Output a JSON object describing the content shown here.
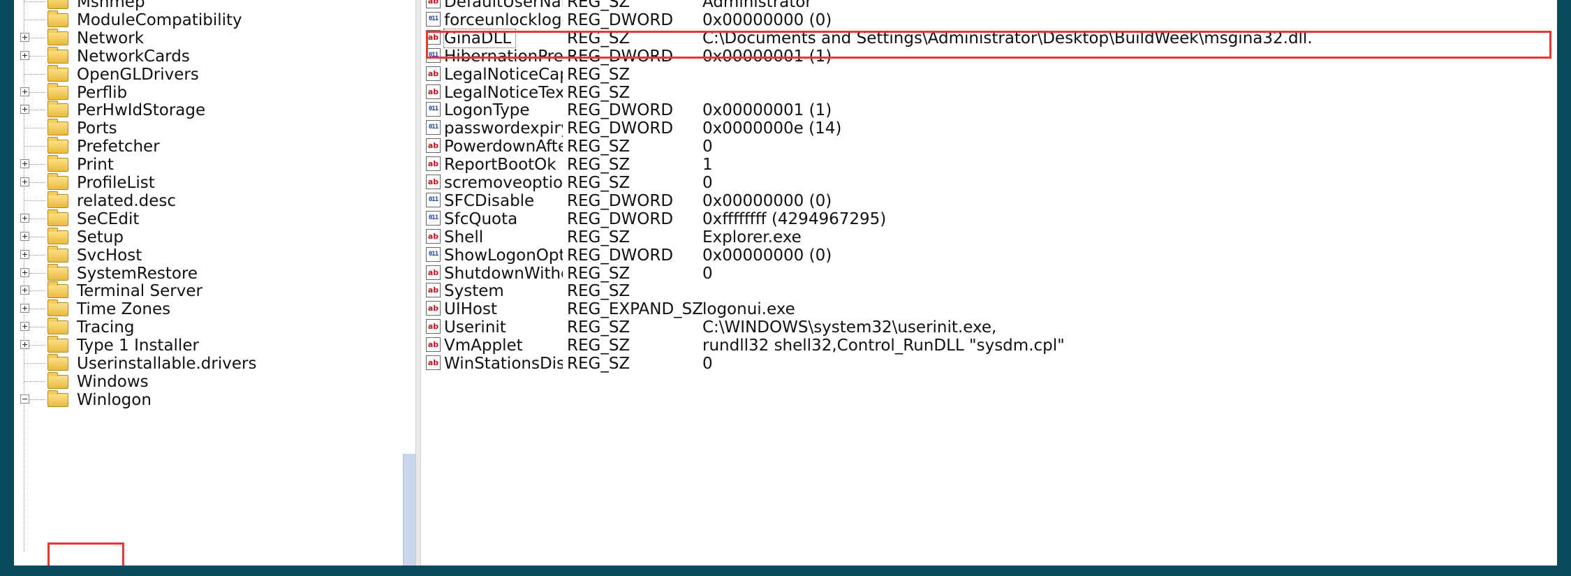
{
  "tree": {
    "items": [
      {
        "label": "Mshmep",
        "expander": "none"
      },
      {
        "label": "ModuleCompatibility",
        "expander": "none"
      },
      {
        "label": "Network",
        "expander": "plus"
      },
      {
        "label": "NetworkCards",
        "expander": "plus"
      },
      {
        "label": "OpenGLDrivers",
        "expander": "none"
      },
      {
        "label": "Perflib",
        "expander": "plus"
      },
      {
        "label": "PerHwIdStorage",
        "expander": "plus"
      },
      {
        "label": "Ports",
        "expander": "none"
      },
      {
        "label": "Prefetcher",
        "expander": "none"
      },
      {
        "label": "Print",
        "expander": "plus"
      },
      {
        "label": "ProfileList",
        "expander": "plus"
      },
      {
        "label": "related.desc",
        "expander": "none"
      },
      {
        "label": "SeCEdit",
        "expander": "plus"
      },
      {
        "label": "Setup",
        "expander": "plus"
      },
      {
        "label": "SvcHost",
        "expander": "plus"
      },
      {
        "label": "SystemRestore",
        "expander": "plus"
      },
      {
        "label": "Terminal Server",
        "expander": "plus"
      },
      {
        "label": "Time Zones",
        "expander": "plus"
      },
      {
        "label": "Tracing",
        "expander": "plus"
      },
      {
        "label": "Type 1 Installer",
        "expander": "plus"
      },
      {
        "label": "Userinstallable.drivers",
        "expander": "none"
      },
      {
        "label": "Windows",
        "expander": "none"
      },
      {
        "label": "Winlogon",
        "expander": "minus"
      }
    ]
  },
  "values": [
    {
      "icon": "sz",
      "name": "DefaultUserName",
      "type": "REG_SZ",
      "data": "Administrator"
    },
    {
      "icon": "dword",
      "name": "forceunlocklogon",
      "type": "REG_DWORD",
      "data": "0x00000000 (0)"
    },
    {
      "icon": "sz",
      "name": "GinaDLL",
      "type": "REG_SZ",
      "data": "C:\\Documents and Settings\\Administrator\\Desktop\\BuildWeek\\msgina32.dll."
    },
    {
      "icon": "dword",
      "name": "HibernationPrevi...",
      "type": "REG_DWORD",
      "data": "0x00000001 (1)"
    },
    {
      "icon": "sz",
      "name": "LegalNoticeCaption",
      "type": "REG_SZ",
      "data": ""
    },
    {
      "icon": "sz",
      "name": "LegalNoticeText",
      "type": "REG_SZ",
      "data": ""
    },
    {
      "icon": "dword",
      "name": "LogonType",
      "type": "REG_DWORD",
      "data": "0x00000001 (1)"
    },
    {
      "icon": "dword",
      "name": "passwordexpiryw...",
      "type": "REG_DWORD",
      "data": "0x0000000e (14)"
    },
    {
      "icon": "sz",
      "name": "PowerdownAfter...",
      "type": "REG_SZ",
      "data": "0"
    },
    {
      "icon": "sz",
      "name": "ReportBootOk",
      "type": "REG_SZ",
      "data": "1"
    },
    {
      "icon": "sz",
      "name": "scremoveoption",
      "type": "REG_SZ",
      "data": "0"
    },
    {
      "icon": "dword",
      "name": "SFCDisable",
      "type": "REG_DWORD",
      "data": "0x00000000 (0)"
    },
    {
      "icon": "dword",
      "name": "SfcQuota",
      "type": "REG_DWORD",
      "data": "0xffffffff (4294967295)"
    },
    {
      "icon": "sz",
      "name": "Shell",
      "type": "REG_SZ",
      "data": "Explorer.exe"
    },
    {
      "icon": "dword",
      "name": "ShowLogonOptions",
      "type": "REG_DWORD",
      "data": "0x00000000 (0)"
    },
    {
      "icon": "sz",
      "name": "ShutdownWithou...",
      "type": "REG_SZ",
      "data": "0"
    },
    {
      "icon": "sz",
      "name": "System",
      "type": "REG_SZ",
      "data": ""
    },
    {
      "icon": "sz",
      "name": "UIHost",
      "type": "REG_EXPAND_SZ",
      "data": "logonui.exe"
    },
    {
      "icon": "sz",
      "name": "Userinit",
      "type": "REG_SZ",
      "data": "C:\\WINDOWS\\system32\\userinit.exe,"
    },
    {
      "icon": "sz",
      "name": "VmApplet",
      "type": "REG_SZ",
      "data": "rundll32 shell32,Control_RunDLL \"sysdm.cpl\""
    },
    {
      "icon": "sz",
      "name": "WinStationsDisab...",
      "type": "REG_SZ",
      "data": "0"
    }
  ],
  "icon_glyphs": {
    "sz": "ab",
    "dword": "011\n110"
  },
  "colors": {
    "highlight": "#e53935",
    "background": "#0b4a5c"
  }
}
